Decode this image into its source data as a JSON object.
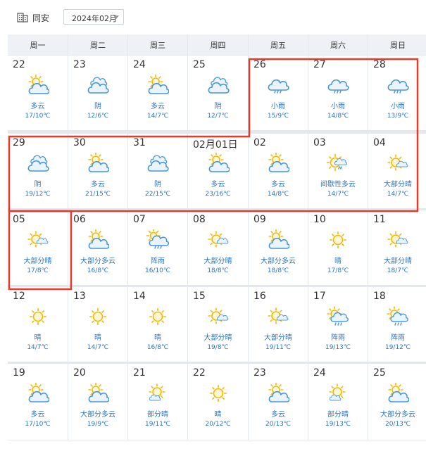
{
  "header": {
    "city": "同安",
    "month_value": "2024年02月"
  },
  "weekdays": [
    "周一",
    "周二",
    "周三",
    "周四",
    "周五",
    "周六",
    "周日"
  ],
  "days": [
    {
      "date": "22",
      "desc": "多云",
      "temp": "17/10℃",
      "icon": "partly-cloudy-icon"
    },
    {
      "date": "23",
      "desc": "阴",
      "temp": "12/6℃",
      "icon": "overcast-icon"
    },
    {
      "date": "24",
      "desc": "多云",
      "temp": "14/7℃",
      "icon": "partly-cloudy-icon"
    },
    {
      "date": "25",
      "desc": "阴",
      "temp": "12/7℃",
      "icon": "overcast-icon"
    },
    {
      "date": "26",
      "desc": "小雨",
      "temp": "15/9℃",
      "icon": "light-rain-icon"
    },
    {
      "date": "27",
      "desc": "小雨",
      "temp": "14/8℃",
      "icon": "light-rain-icon"
    },
    {
      "date": "28",
      "desc": "小雨",
      "temp": "13/9℃",
      "icon": "light-rain-icon"
    },
    {
      "date": "29",
      "desc": "阴",
      "temp": "19/12℃",
      "icon": "overcast-icon"
    },
    {
      "date": "30",
      "desc": "多云",
      "temp": "21/15℃",
      "icon": "partly-cloudy-icon"
    },
    {
      "date": "31",
      "desc": "阴",
      "temp": "22/15℃",
      "icon": "overcast-icon"
    },
    {
      "date": "02月01日",
      "desc": "多云",
      "temp": "23/16℃",
      "icon": "partly-cloudy-icon"
    },
    {
      "date": "02",
      "desc": "多云",
      "temp": "14/8℃",
      "icon": "partly-cloudy-icon"
    },
    {
      "date": "03",
      "desc": "间歇性多云",
      "temp": "14/7℃",
      "icon": "intermittent-cloudy-icon"
    },
    {
      "date": "04",
      "desc": "大部分晴",
      "temp": "14/7℃",
      "icon": "mostly-sunny-icon"
    },
    {
      "date": "05",
      "desc": "大部分晴",
      "temp": "17/8℃",
      "icon": "mostly-sunny-icon"
    },
    {
      "date": "06",
      "desc": "大部分多云",
      "temp": "16/8℃",
      "icon": "partly-cloudy-icon"
    },
    {
      "date": "07",
      "desc": "阵雨",
      "temp": "16/10℃",
      "icon": "shower-icon"
    },
    {
      "date": "08",
      "desc": "大部分晴",
      "temp": "18/8℃",
      "icon": "mostly-sunny-icon"
    },
    {
      "date": "09",
      "desc": "大部分多云",
      "temp": "18/8℃",
      "icon": "partly-cloudy-icon"
    },
    {
      "date": "10",
      "desc": "晴",
      "temp": "17/8℃",
      "icon": "sunny-icon"
    },
    {
      "date": "11",
      "desc": "大部分晴",
      "temp": "18/7℃",
      "icon": "mostly-sunny-icon"
    },
    {
      "date": "12",
      "desc": "晴",
      "temp": "14/7℃",
      "icon": "sunny-icon"
    },
    {
      "date": "13",
      "desc": "晴",
      "temp": "14/7℃",
      "icon": "sunny-icon"
    },
    {
      "date": "14",
      "desc": "晴",
      "temp": "16/8℃",
      "icon": "sunny-icon"
    },
    {
      "date": "15",
      "desc": "大部分晴",
      "temp": "19/8℃",
      "icon": "mostly-sunny-icon"
    },
    {
      "date": "16",
      "desc": "大部分晴",
      "temp": "19/11℃",
      "icon": "mostly-sunny-icon"
    },
    {
      "date": "17",
      "desc": "阵雨",
      "temp": "19/13℃",
      "icon": "sun-shower-icon"
    },
    {
      "date": "18",
      "desc": "阵雨",
      "temp": "19/12℃",
      "icon": "sun-shower-icon"
    },
    {
      "date": "19",
      "desc": "多云",
      "temp": "17/10℃",
      "icon": "partly-cloudy-icon"
    },
    {
      "date": "20",
      "desc": "大部分多云",
      "temp": "19/9℃",
      "icon": "partly-cloudy-icon"
    },
    {
      "date": "21",
      "desc": "部分晴",
      "temp": "19/11℃",
      "icon": "part-sunny-icon"
    },
    {
      "date": "22",
      "desc": "晴",
      "temp": "20/12℃",
      "icon": "sunny-icon"
    },
    {
      "date": "23",
      "desc": "多云",
      "temp": "20/13℃",
      "icon": "partly-cloudy-icon"
    },
    {
      "date": "24",
      "desc": "部分晴",
      "temp": "19/13℃",
      "icon": "part-sunny-icon"
    },
    {
      "date": "25",
      "desc": "大部分多云",
      "temp": "20/13℃",
      "icon": "partly-cloudy-icon"
    }
  ],
  "colors": {
    "highlight": "#e8392b",
    "text_blue": "#2a74c5",
    "sun": "#f5b800",
    "cloud": "#4a95d6"
  }
}
